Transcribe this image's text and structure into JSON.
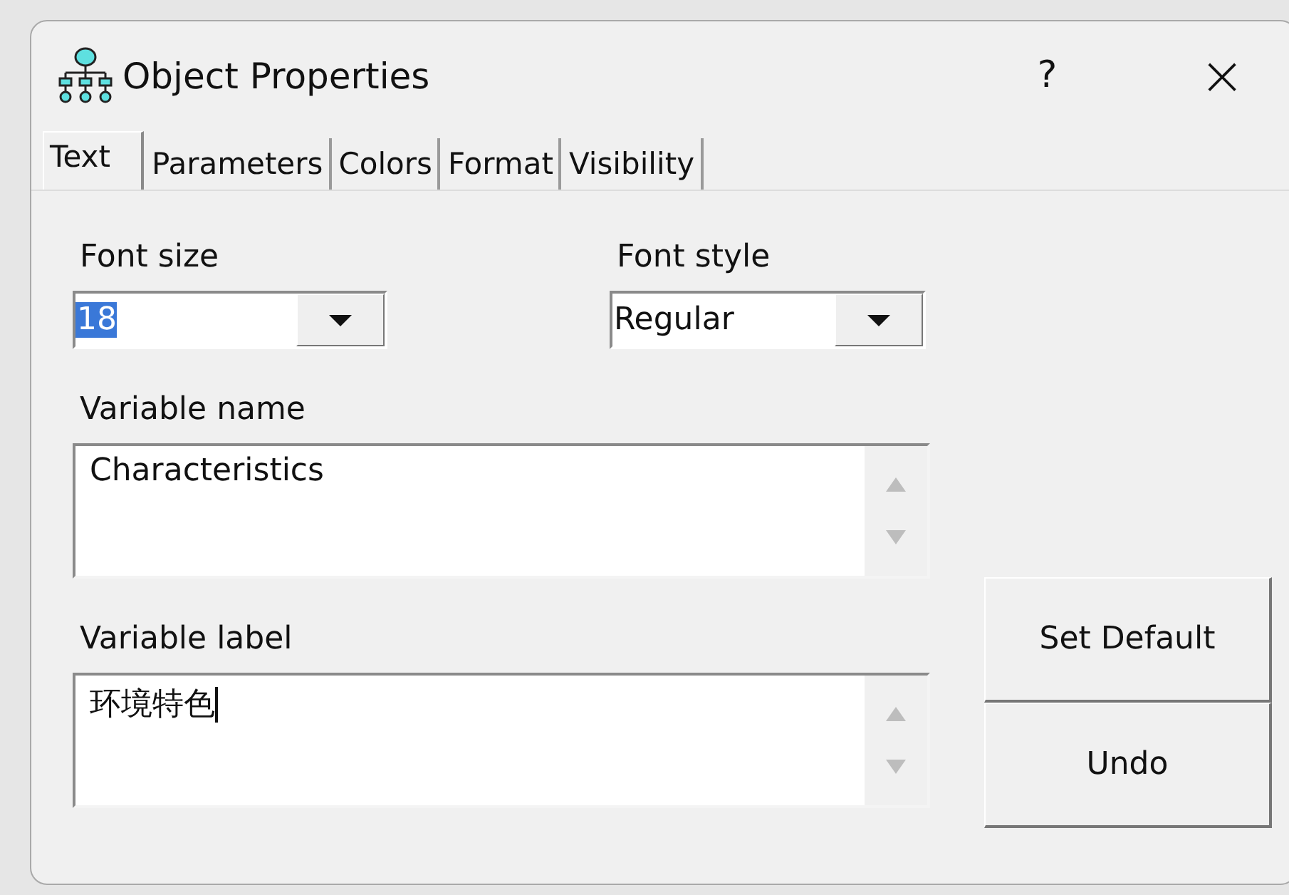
{
  "window": {
    "title": "Object Properties",
    "help_button": "?",
    "close_button": "×"
  },
  "tabs": [
    {
      "label": "Text",
      "selected": true
    },
    {
      "label": "Parameters",
      "selected": false
    },
    {
      "label": "Colors",
      "selected": false
    },
    {
      "label": "Format",
      "selected": false
    },
    {
      "label": "Visibility",
      "selected": false
    }
  ],
  "font_size": {
    "label": "Font size",
    "value": "18",
    "selected": true
  },
  "font_style": {
    "label": "Font style",
    "value": "Regular",
    "selected": false
  },
  "variable_name": {
    "label": "Variable name",
    "value": "Characteristics",
    "focused": false
  },
  "variable_label": {
    "label": "Variable label",
    "value": "环境特色",
    "focused": true
  },
  "buttons": [
    "Set Default",
    "Undo"
  ]
}
